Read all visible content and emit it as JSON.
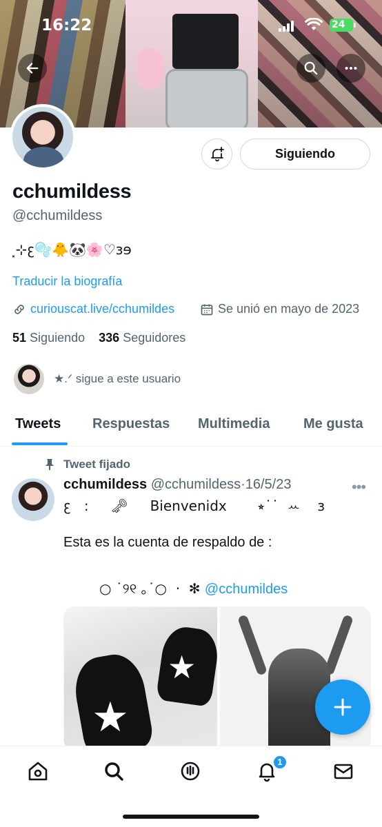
{
  "status_bar": {
    "time": "16:22",
    "battery": "24"
  },
  "profile": {
    "name": "cchumildess",
    "handle": "@cchumildess",
    "bio": "⸼⊹ꜫ🫧🐥🐼🌸♡ɜɘ",
    "translate_label": "Traducir la biografía",
    "website": "curiouscat.live/cchumildes",
    "joined": "Se unió en mayo de 2023",
    "following_count": "51",
    "following_label": "Siguiendo",
    "followers_count": "336",
    "followers_label": "Seguidores",
    "followed_by_text": "★.ᐟ sigue a este usuario",
    "follow_button_label": "Siguiendo"
  },
  "tabs": [
    {
      "label": "Tweets",
      "active": true
    },
    {
      "label": "Respuestas",
      "active": false
    },
    {
      "label": "Multimedia",
      "active": false
    },
    {
      "label": "Me gusta",
      "active": false
    }
  ],
  "tweet": {
    "pinned_label": "Tweet fijado",
    "author_name": "cchumildess",
    "author_handle": "@cchumildess",
    "separator": "·",
    "date": "16/5/23",
    "line1": "ꜫ   :     🗝     Bienvenidx       ⭒˙˙  ꕀ    ɜ",
    "line2": "Esta es la cuenta de respaldo de :",
    "line3_deco": "○ ˙୨୧ ｡˙○  ·  ✻ ",
    "line3_mention": "@cchumildes"
  },
  "notifications": {
    "badge_count": "1"
  },
  "colors": {
    "accent": "#1d9bf0",
    "text": "#0f1419",
    "secondary": "#536471",
    "border": "#cfd9de"
  }
}
